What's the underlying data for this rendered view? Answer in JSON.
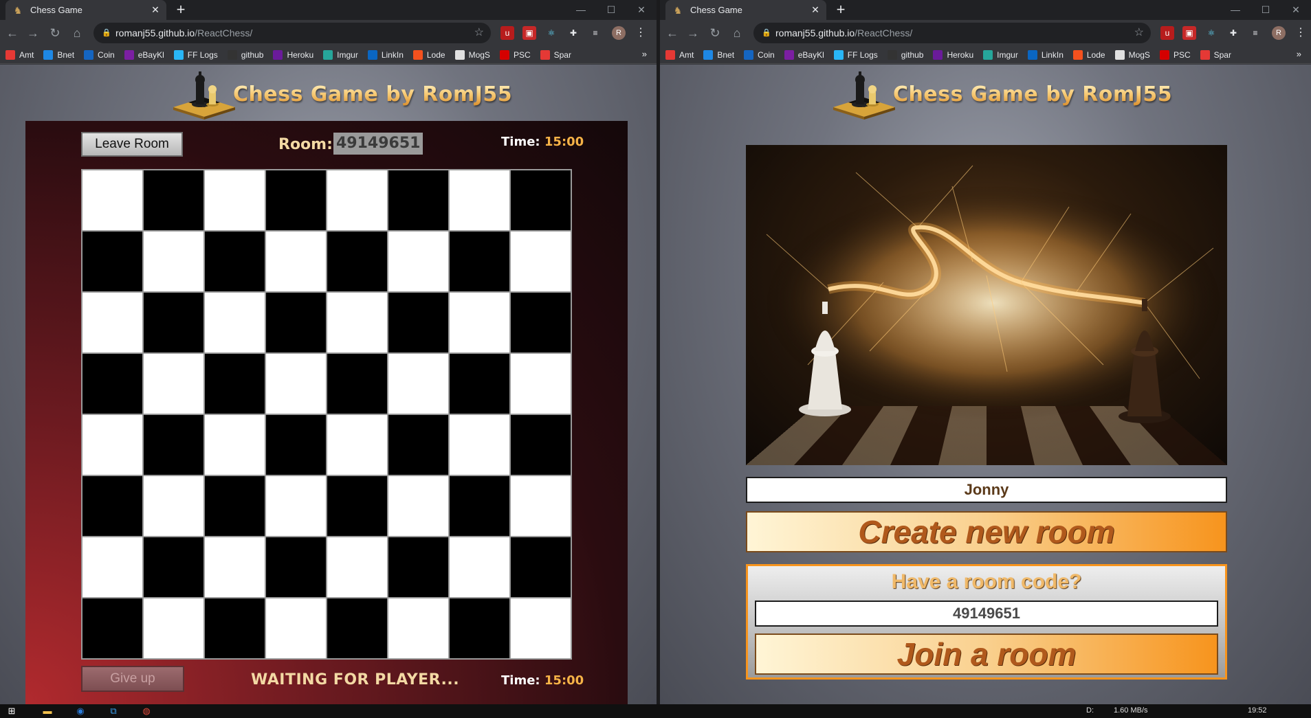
{
  "left": {
    "tab_title": "Chess Game",
    "url_host": "romanj55.github.io",
    "url_path": "/ReactChess/",
    "logo_text": "Chess Game by RomJ55",
    "leave_label": "Leave Room",
    "room_label": "Room:",
    "room_code": "49149651",
    "time_label": "Time:",
    "time_top": "15:00",
    "time_bottom": "15:00",
    "giveup_label": "Give up",
    "status": "WAITING FOR PLAYER..."
  },
  "right": {
    "tab_title": "Chess Game",
    "url_host": "romanj55.github.io",
    "url_path": "/ReactChess/",
    "logo_text": "Chess Game by RomJ55",
    "name_value": "Jonny",
    "create_label": "Create new room",
    "join_title": "Have a room code?",
    "code_value": "49149651",
    "join_label": "Join a room"
  },
  "bookmarks": [
    "Amt",
    "Bnet",
    "Coin",
    "eBayKl",
    "FF Logs",
    "github",
    "Heroku",
    "Imgur",
    "LinkIn",
    "Lode",
    "MogS",
    "PSC",
    "Spar"
  ],
  "bookmark_colors": [
    "#e53935",
    "#1e88e5",
    "#1565c0",
    "#7b1fa2",
    "#29b6f6",
    "#333333",
    "#6a1b9a",
    "#26a69a",
    "#0a66c2",
    "#f4511e",
    "#e0e0e0",
    "#d50000",
    "#e53935"
  ],
  "avatar_letter": "R",
  "taskbar": {
    "drive": "D:",
    "speed": "1.60 MB/s",
    "clock": "19:52"
  },
  "colors": {
    "accent_orange": "#f7941d",
    "panel_red": "#b12a2e",
    "gold_text": "#f3d9a4"
  }
}
